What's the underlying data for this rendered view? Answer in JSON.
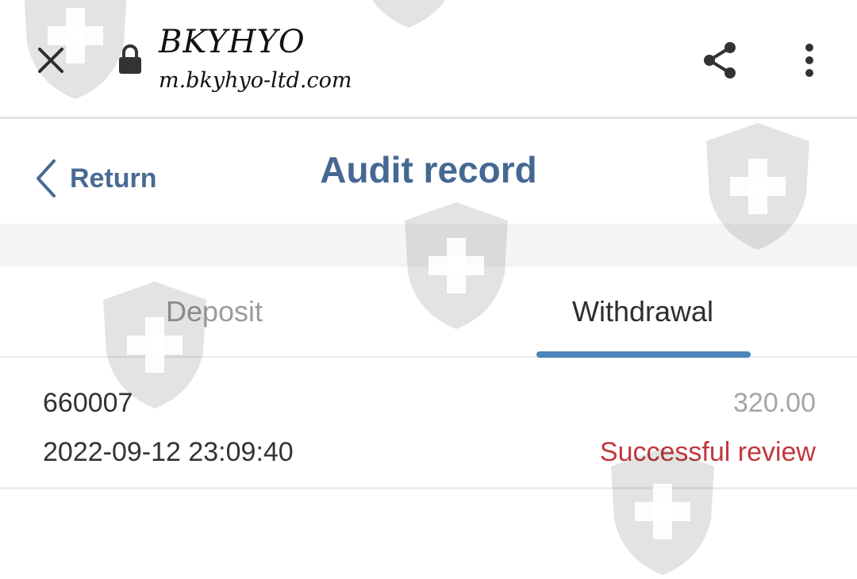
{
  "browser": {
    "site_title": "BKYHYO",
    "url": "m.bkyhyo-ltd.com",
    "icons": [
      "close-icon",
      "lock-icon",
      "share-icon",
      "more-vert-icon"
    ]
  },
  "header": {
    "return_label": "Return",
    "title": "Audit record"
  },
  "tabs": [
    {
      "label": "Deposit",
      "active": false
    },
    {
      "label": "Withdrawal",
      "active": true
    }
  ],
  "records": [
    {
      "id": "660007",
      "amount": "320.00",
      "time": "2022-09-12 23:09:40",
      "status": "Successful review"
    }
  ],
  "colors": {
    "accent": "#456893",
    "tab_indicator": "#4a86b8",
    "status_success": "#c1373d",
    "amount": "#a5a5a5"
  }
}
